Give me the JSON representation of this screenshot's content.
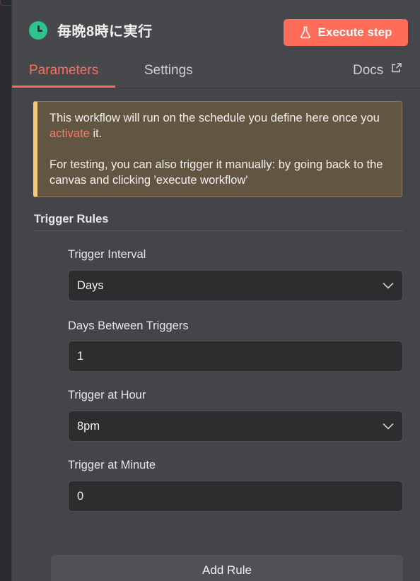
{
  "node": {
    "title": "毎晩8時に実行",
    "execute_label": "Execute step"
  },
  "tabs": {
    "parameters": "Parameters",
    "settings": "Settings",
    "docs": "Docs"
  },
  "notice": {
    "line1_pre": "This workflow will run on the schedule you define here once you ",
    "link": "activate",
    "line1_post": " it.",
    "line2": "For testing, you can also trigger it manually: by going back to the canvas and clicking 'execute workflow'"
  },
  "section": {
    "title": "Trigger Rules"
  },
  "fields": {
    "interval": {
      "label": "Trigger Interval",
      "value": "Days"
    },
    "days_between": {
      "label": "Days Between Triggers",
      "value": "1"
    },
    "hour": {
      "label": "Trigger at Hour",
      "value": "8pm"
    },
    "minute": {
      "label": "Trigger at Minute",
      "value": "0"
    }
  },
  "add_rule_label": "Add Rule",
  "colors": {
    "accent": "#ff6d5a",
    "clock": "#2ec28f",
    "notice_bg": "#625541",
    "notice_border": "#f4c97e"
  },
  "icons": [
    "clock-icon",
    "flask-icon",
    "external-link-icon",
    "chevron-down-icon"
  ]
}
